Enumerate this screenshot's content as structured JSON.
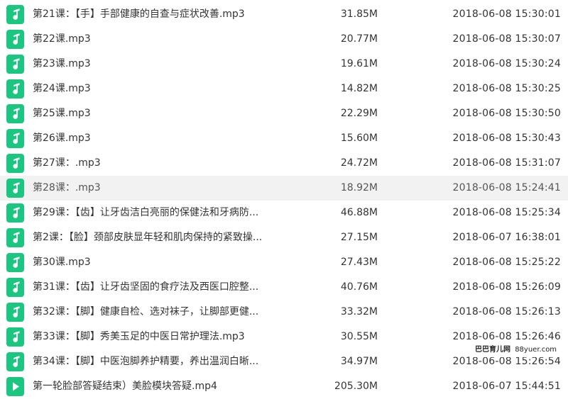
{
  "colors": {
    "audio_icon": "#1bc780",
    "video_icon": "#1bc780",
    "hover_row": "#f2f2f2"
  },
  "files": [
    {
      "name": "第21课：【手】手部健康的自查与症状改善.mp3",
      "size": "31.85M",
      "date": "2018-06-08 15:30:01",
      "icon": "music-note-icon"
    },
    {
      "name": "第22课.mp3",
      "size": "20.77M",
      "date": "2018-06-08 15:30:07",
      "icon": "music-note-icon"
    },
    {
      "name": "第23课.mp3",
      "size": "19.61M",
      "date": "2018-06-08 15:30:24",
      "icon": "music-note-icon"
    },
    {
      "name": "第24课.mp3",
      "size": "14.82M",
      "date": "2018-06-08 15:30:25",
      "icon": "music-note-icon"
    },
    {
      "name": "第25课.mp3",
      "size": "22.29M",
      "date": "2018-06-08 15:30:50",
      "icon": "music-note-icon"
    },
    {
      "name": "第26课.mp3",
      "size": "15.60M",
      "date": "2018-06-08 15:30:43",
      "icon": "music-note-icon"
    },
    {
      "name": "第27课：.mp3",
      "size": "24.72M",
      "date": "2018-06-08 15:31:07",
      "icon": "music-note-icon"
    },
    {
      "name": "第28课：.mp3",
      "size": "18.92M",
      "date": "2018-06-08 15:24:41",
      "icon": "music-note-icon",
      "hover": true
    },
    {
      "name": "第29课：【齿】让牙齿洁白亮丽的保健法和牙病防...",
      "size": "46.88M",
      "date": "2018-06-08 15:25:34",
      "icon": "music-note-icon"
    },
    {
      "name": "第2课：【脸】颈部皮肤显年轻和肌肉保持的紧致操...",
      "size": "27.15M",
      "date": "2018-06-07 16:38:01",
      "icon": "music-note-icon"
    },
    {
      "name": "第30课.mp3",
      "size": "27.43M",
      "date": "2018-06-08 15:25:22",
      "icon": "music-note-icon"
    },
    {
      "name": "第31课：【齿】让牙齿坚固的食疗法及西医口腔整...",
      "size": "40.76M",
      "date": "2018-06-08 15:26:09",
      "icon": "music-note-icon"
    },
    {
      "name": "第32课：【脚】健康自检、选对袜子，让脚部更健...",
      "size": "33.32M",
      "date": "2018-06-08 15:26:13",
      "icon": "music-note-icon"
    },
    {
      "name": "第33课：【脚】秀美玉足的中医日常护理法.mp3",
      "size": "30.55M",
      "date": "2018-06-08 15:26:46",
      "icon": "music-note-icon"
    },
    {
      "name": "第34课：【脚】中医泡脚养护精要，养出温润白晰...",
      "size": "34.97M",
      "date": "2018-06-08 15:26:54",
      "icon": "music-note-icon"
    },
    {
      "name": "第一轮脸部答疑结束）美脸模块答疑.mp4",
      "size": "205.30M",
      "date": "2018-06-07 15:44:51",
      "icon": "play-icon"
    }
  ],
  "watermark": {
    "cn": "巴巴育儿网",
    "en": "88yuer.com"
  }
}
